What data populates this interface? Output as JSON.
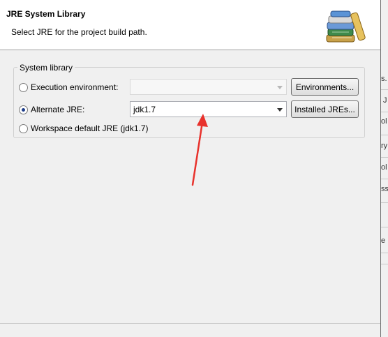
{
  "banner": {
    "title": "JRE System Library",
    "message": "Select JRE for the project build path."
  },
  "group": {
    "label": "System library",
    "execution_env": {
      "label": "Execution environment:",
      "value": "",
      "button": "Environments..."
    },
    "alternate_jre": {
      "label": "Alternate JRE:",
      "value": "jdk1.7",
      "button": "Installed JREs..."
    },
    "workspace_default": {
      "label": "Workspace default JRE (jdk1.7)"
    },
    "selected": "alternate_jre"
  },
  "annotation": {
    "arrow_color": "#e8322c"
  },
  "background_window": {
    "fragments": [
      "s.",
      "J",
      "ol",
      "ry",
      "ol",
      "ss",
      "e"
    ]
  },
  "colors": {
    "banner_bg": "#ffffff",
    "dialog_bg": "#f0f0f0",
    "radio_dot": "#1f3e8a"
  }
}
